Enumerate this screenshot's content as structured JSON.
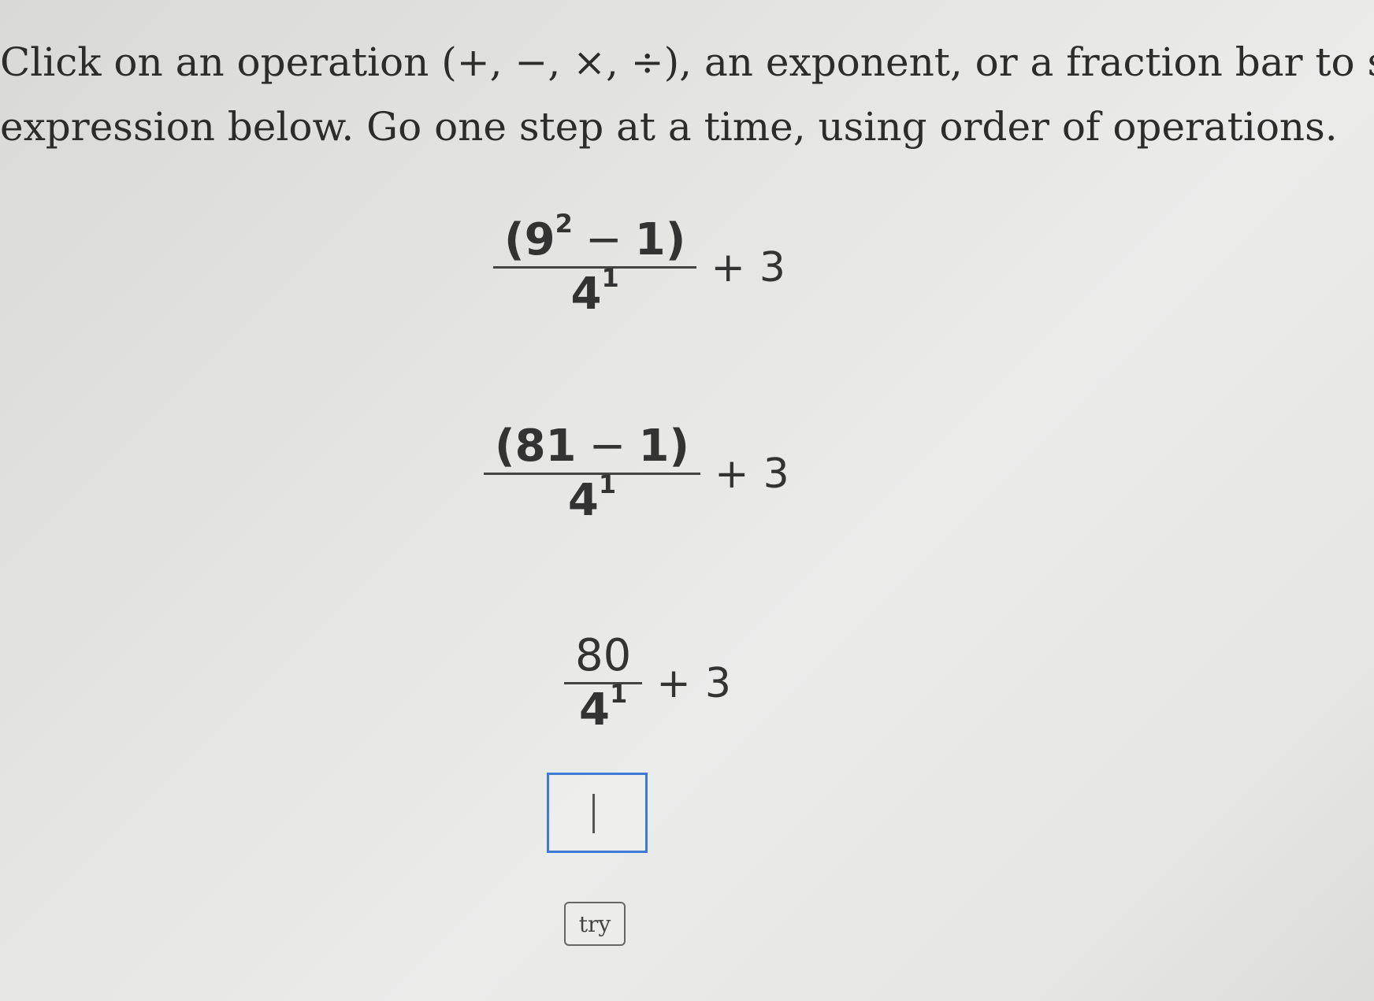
{
  "instructions": {
    "line1": "Click on an operation (+, −, ×, ÷), an exponent, or a fraction bar to sim",
    "line2": "expression below. Go one step at a time, using order of operations."
  },
  "step1": {
    "open_paren": "(",
    "base": "9",
    "exponent": "2",
    "minus": "−",
    "subtrahend": "1",
    "close_paren": ")",
    "den_base": "4",
    "den_exponent": "1",
    "plus": "+",
    "addend": "3"
  },
  "step2": {
    "open_paren": "(",
    "minuend": "81",
    "minus": "−",
    "subtrahend": "1",
    "close_paren": ")",
    "den_base": "4",
    "den_exponent": "1",
    "plus": "+",
    "addend": "3"
  },
  "step3": {
    "numerator": "80",
    "den_base": "4",
    "den_exponent": "1",
    "plus": "+",
    "addend": "3"
  },
  "answer": {
    "value": ""
  },
  "try_button": {
    "label": "try"
  },
  "colors": {
    "answer_border": "#3d7ad6",
    "text": "#2f2f2f"
  }
}
